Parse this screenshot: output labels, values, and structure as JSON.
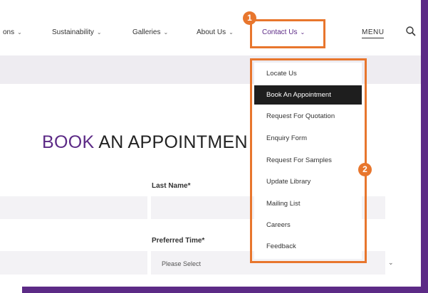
{
  "nav": {
    "items": [
      {
        "label": "ons",
        "chevron": "chevron-down-icon"
      },
      {
        "label": "Sustainability",
        "chevron": "chevron-down-icon"
      },
      {
        "label": "Galleries",
        "chevron": "chevron-down-icon"
      },
      {
        "label": "About Us",
        "chevron": "chevron-down-icon"
      },
      {
        "label": "Contact Us",
        "chevron": "chevron-down-icon"
      }
    ],
    "menu_label": "MENU",
    "search_icon": "search-icon"
  },
  "dropdown": {
    "items": [
      {
        "label": "Locate Us"
      },
      {
        "label": "Book An Appointment",
        "active": true
      },
      {
        "label": "Request For Quotation"
      },
      {
        "label": "Enquiry Form"
      },
      {
        "label": "Request For Samples"
      },
      {
        "label": "Update Library"
      },
      {
        "label": "Mailing List"
      },
      {
        "label": "Careers"
      },
      {
        "label": "Feedback"
      }
    ]
  },
  "heading": {
    "accent": "BOOK",
    "rest": " AN APPOINTMEN"
  },
  "form": {
    "last_name_label": "Last Name*",
    "preferred_time_label": "Preferred Time*",
    "preferred_time_value": "Please Select"
  },
  "annotations": {
    "badge_1": "1",
    "badge_2": "2"
  },
  "colors": {
    "accent": "#5c2a86",
    "annotation": "#e8762d",
    "active_item_bg": "#1e1e1e",
    "field_bg": "#f3f2f5"
  }
}
